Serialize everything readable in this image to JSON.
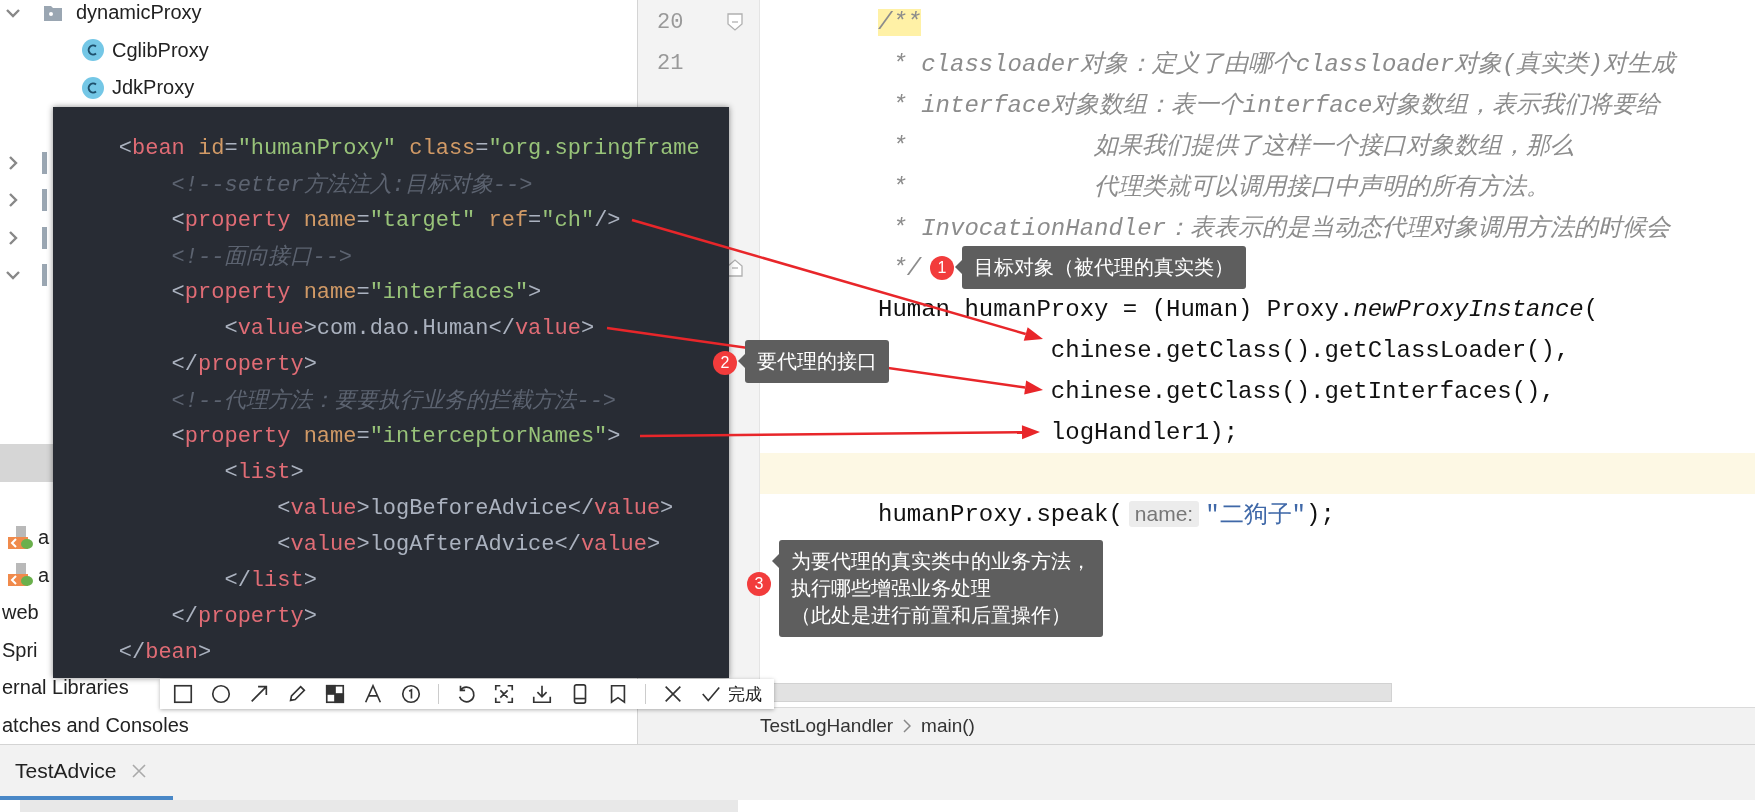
{
  "project_tree": {
    "top": [
      {
        "kind": "folder",
        "label": "dynamicProxy",
        "expanded": true
      },
      {
        "kind": "class",
        "label": "CglibProxy"
      },
      {
        "kind": "class",
        "label": "JdkProxy"
      }
    ],
    "nodes": [
      {
        "expanded": false
      },
      {
        "expanded": false
      },
      {
        "expanded": false
      },
      {
        "expanded": true
      }
    ],
    "selected_row": {
      "selected": true
    },
    "lower": [
      {
        "kind": "xml",
        "label": "a"
      },
      {
        "kind": "xml",
        "label": "a"
      },
      {
        "kind": "plain",
        "label": "web"
      },
      {
        "kind": "plain",
        "label": "Spri"
      },
      {
        "kind": "plain",
        "label": "ernal Libraries"
      },
      {
        "kind": "plain",
        "label": "atches and Consoles"
      }
    ]
  },
  "editor": {
    "line_numbers": [
      "20",
      "21"
    ],
    "lines": [
      {
        "current": false,
        "segments": [
          {
            "kind": "doc",
            "text": "/**"
          }
        ]
      },
      {
        "current": false,
        "segments": [
          {
            "kind": "comment",
            "text": " * classloader对象：定义了由哪个classloader对象(真实类)对生成"
          }
        ]
      },
      {
        "current": false,
        "segments": [
          {
            "kind": "comment",
            "text": " * interface对象数组：表一个interface对象数组，表示我们将要给"
          }
        ]
      },
      {
        "current": false,
        "segments": [
          {
            "kind": "comment",
            "text": " *             如果我们提供了这样一个接口对象数组，那么"
          }
        ]
      },
      {
        "current": false,
        "segments": [
          {
            "kind": "comment",
            "text": " *             代理类就可以调用接口中声明的所有方法。"
          }
        ]
      },
      {
        "current": false,
        "segments": [
          {
            "kind": "comment",
            "text": " * InvocationHandler：表表示的是当动态代理对象调用方法的时候会"
          }
        ]
      },
      {
        "current": false,
        "segments": [
          {
            "kind": "comment",
            "text": " */"
          }
        ]
      },
      {
        "current": false,
        "segments": [
          {
            "kind": "plain",
            "text": "Human humanProxy = (Human) Proxy."
          },
          {
            "kind": "italic",
            "text": "newProxyInstance"
          },
          {
            "kind": "plain",
            "text": "("
          }
        ]
      },
      {
        "current": false,
        "segments": [
          {
            "kind": "plain",
            "text": "            chinese.getClass().getClassLoader(),"
          }
        ]
      },
      {
        "current": false,
        "segments": [
          {
            "kind": "plain",
            "text": "            chinese.getClass().getInterfaces(),"
          }
        ]
      },
      {
        "current": false,
        "segments": [
          {
            "kind": "plain",
            "text": "            logHandler1);"
          }
        ]
      },
      {
        "current": true
      },
      {
        "current": false,
        "segments": [
          {
            "kind": "plain",
            "text": "humanProxy.speak("
          },
          {
            "kind": "hint",
            "text": "name:"
          },
          {
            "kind": "string",
            "text": "\"二狗子\""
          },
          {
            "kind": "plain",
            "text": ");"
          }
        ]
      }
    ]
  },
  "breadcrumb": [
    "TestLogHandler",
    "main()"
  ],
  "bottom_tabs": [
    {
      "label": "TestAdvice",
      "selected": true
    }
  ],
  "popup": {
    "lines": [
      [
        {
          "kind": "text",
          "text": "    <"
        },
        {
          "kind": "tag",
          "text": "bean"
        },
        {
          "kind": "attr",
          "text": " id"
        },
        {
          "kind": "text",
          "text": "="
        },
        {
          "kind": "value",
          "text": "\"humanProxy\""
        },
        {
          "kind": "attr",
          "text": " class"
        },
        {
          "kind": "text",
          "text": "="
        },
        {
          "kind": "value",
          "text": "\"org.springframe"
        }
      ],
      [
        {
          "kind": "comment",
          "text": "        <!--setter方法注入:目标对象-->"
        }
      ],
      [
        {
          "kind": "text",
          "text": "        <"
        },
        {
          "kind": "tag",
          "text": "property"
        },
        {
          "kind": "attr",
          "text": " name"
        },
        {
          "kind": "text",
          "text": "="
        },
        {
          "kind": "value",
          "text": "\"target\""
        },
        {
          "kind": "attr",
          "text": " ref"
        },
        {
          "kind": "text",
          "text": "="
        },
        {
          "kind": "value",
          "text": "\"ch\""
        },
        {
          "kind": "text",
          "text": "/>"
        }
      ],
      [
        {
          "kind": "comment",
          "text": "        <!--面向接口-->"
        }
      ],
      [
        {
          "kind": "text",
          "text": "        <"
        },
        {
          "kind": "tag",
          "text": "property"
        },
        {
          "kind": "attr",
          "text": " name"
        },
        {
          "kind": "text",
          "text": "="
        },
        {
          "kind": "value",
          "text": "\"interfaces\""
        },
        {
          "kind": "text",
          "text": ">"
        }
      ],
      [
        {
          "kind": "text",
          "text": "            <"
        },
        {
          "kind": "tag",
          "text": "value"
        },
        {
          "kind": "text",
          "text": ">com.dao.Human</"
        },
        {
          "kind": "tag",
          "text": "value"
        },
        {
          "kind": "text",
          "text": ">"
        }
      ],
      [
        {
          "kind": "text",
          "text": "        </"
        },
        {
          "kind": "tag",
          "text": "property"
        },
        {
          "kind": "text",
          "text": ">"
        }
      ],
      [
        {
          "kind": "comment",
          "text": "        <!--代理方法：要要执行业务的拦截方法-->"
        }
      ],
      [
        {
          "kind": "text",
          "text": "        <"
        },
        {
          "kind": "tag",
          "text": "property"
        },
        {
          "kind": "attr",
          "text": " name"
        },
        {
          "kind": "text",
          "text": "="
        },
        {
          "kind": "value",
          "text": "\"interceptorNames\""
        },
        {
          "kind": "text",
          "text": ">"
        }
      ],
      [
        {
          "kind": "text",
          "text": "            <"
        },
        {
          "kind": "tag",
          "text": "list"
        },
        {
          "kind": "text",
          "text": ">"
        }
      ],
      [
        {
          "kind": "text",
          "text": "                <"
        },
        {
          "kind": "tag",
          "text": "value"
        },
        {
          "kind": "text",
          "text": ">logBeforeAdvice</"
        },
        {
          "kind": "tag",
          "text": "value"
        },
        {
          "kind": "text",
          "text": ">"
        }
      ],
      [
        {
          "kind": "text",
          "text": "                <"
        },
        {
          "kind": "tag",
          "text": "value"
        },
        {
          "kind": "text",
          "text": ">logAfterAdvice</"
        },
        {
          "kind": "tag",
          "text": "value"
        },
        {
          "kind": "text",
          "text": ">"
        }
      ],
      [
        {
          "kind": "text",
          "text": "            </"
        },
        {
          "kind": "tag",
          "text": "list"
        },
        {
          "kind": "text",
          "text": ">"
        }
      ],
      [
        {
          "kind": "text",
          "text": "        </"
        },
        {
          "kind": "tag",
          "text": "property"
        },
        {
          "kind": "text",
          "text": ">"
        }
      ],
      [
        {
          "kind": "text",
          "text": "    </"
        },
        {
          "kind": "tag",
          "text": "bean"
        },
        {
          "kind": "text",
          "text": ">"
        }
      ]
    ]
  },
  "callouts": [
    {
      "number": "1",
      "text": "目标对象（被代理的真实类）"
    },
    {
      "number": "2",
      "text": "要代理的接口"
    },
    {
      "number": "3",
      "lines": [
        "为要代理的真实类中的业务方法，",
        "执行哪些增强业务处理",
        "（此处是进行前置和后置操作）"
      ]
    }
  ],
  "screenshot_toolbar": {
    "done_label": "完成"
  }
}
